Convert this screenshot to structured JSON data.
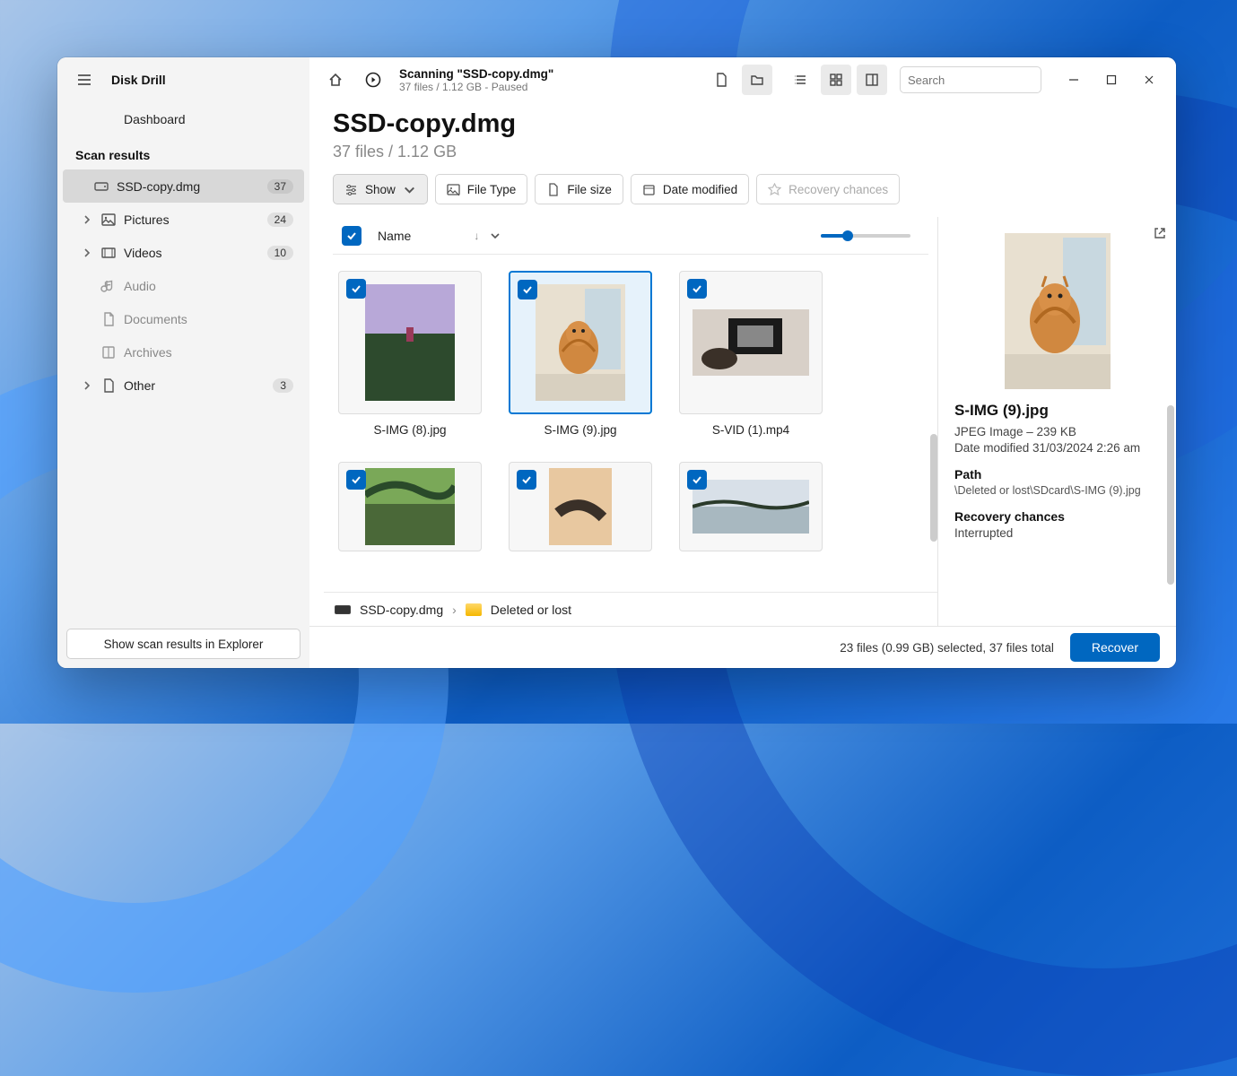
{
  "app": {
    "title": "Disk Drill"
  },
  "sidebar": {
    "dashboard": "Dashboard",
    "section": "Scan results",
    "items": [
      {
        "label": "SSD-copy.dmg",
        "badge": "37",
        "icon": "disk",
        "active": true,
        "chev": false
      },
      {
        "label": "Pictures",
        "badge": "24",
        "icon": "picture",
        "chev": true
      },
      {
        "label": "Videos",
        "badge": "10",
        "icon": "video",
        "chev": true
      },
      {
        "label": "Audio",
        "badge": "",
        "icon": "audio",
        "chev": false
      },
      {
        "label": "Documents",
        "badge": "",
        "icon": "doc",
        "chev": false
      },
      {
        "label": "Archives",
        "badge": "",
        "icon": "archive",
        "chev": false
      },
      {
        "label": "Other",
        "badge": "3",
        "icon": "other",
        "chev": true
      }
    ],
    "footer_button": "Show scan results in Explorer"
  },
  "topbar": {
    "status_title": "Scanning \"SSD-copy.dmg\"",
    "status_sub": "37 files / 1.12 GB - Paused",
    "search_placeholder": "Search"
  },
  "title": {
    "name": "SSD-copy.dmg",
    "stats": "37 files / 1.12 GB"
  },
  "filters": {
    "show": "Show",
    "file_type": "File Type",
    "file_size": "File size",
    "date_modified": "Date modified",
    "recovery": "Recovery chances"
  },
  "list": {
    "name_col": "Name",
    "files": [
      {
        "name": "S-IMG (8).jpg",
        "selected": false,
        "aspect": "tall"
      },
      {
        "name": "S-IMG (9).jpg",
        "selected": true,
        "aspect": "tall"
      },
      {
        "name": "S-VID (1).mp4",
        "selected": false,
        "aspect": "wide"
      },
      {
        "name": "",
        "selected": false,
        "aspect": "tall"
      },
      {
        "name": "",
        "selected": false,
        "aspect": "tall"
      },
      {
        "name": "",
        "selected": false,
        "aspect": "wide"
      }
    ]
  },
  "breadcrumb": {
    "root": "SSD-copy.dmg",
    "leaf": "Deleted or lost"
  },
  "detail": {
    "name": "S-IMG (9).jpg",
    "meta1": "JPEG Image – 239 KB",
    "meta2": "Date modified 31/03/2024 2:26 am",
    "path_label": "Path",
    "path": "\\Deleted or lost\\SDcard\\S-IMG (9).jpg",
    "recovery_label": "Recovery chances",
    "recovery": "Interrupted"
  },
  "statusbar": {
    "text": "23 files (0.99 GB) selected, 37 files total",
    "recover": "Recover"
  }
}
